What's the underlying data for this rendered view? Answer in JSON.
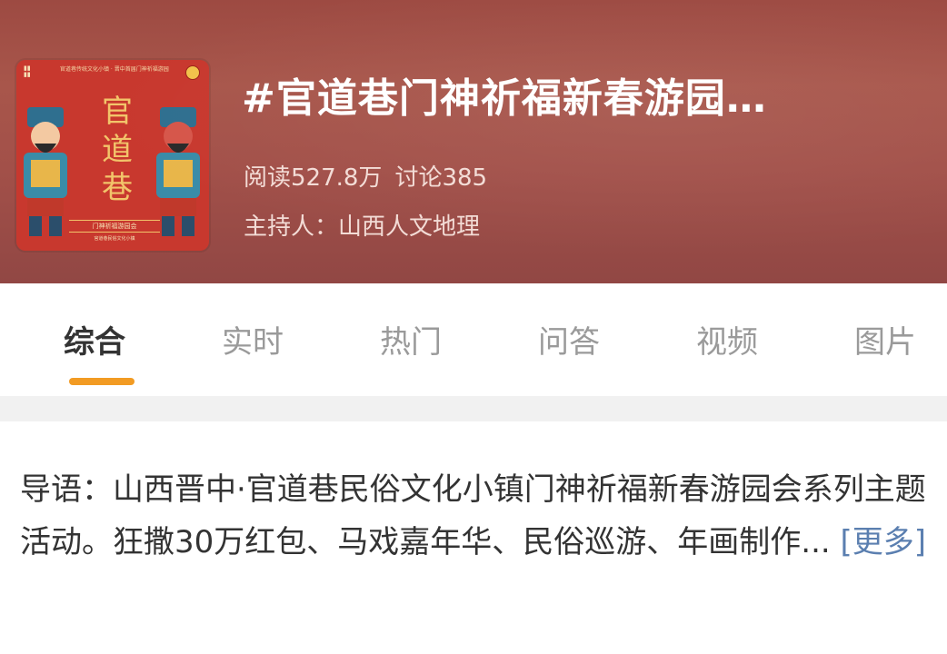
{
  "topic": {
    "title": "#官道巷门神祈福新春游园…",
    "reads": "阅读527.8万",
    "discussions": "讨论385",
    "host": "主持人：山西人文地理",
    "cover": {
      "title": "官道巷",
      "subtitle": "门神祈福游园会",
      "top_text": "官道巷传统文化小镇 · 晋中首届门神祈福游园",
      "footer": "官道巷民俗文化小镇"
    }
  },
  "tabs": [
    {
      "label": "综合",
      "active": true
    },
    {
      "label": "实时",
      "active": false
    },
    {
      "label": "热门",
      "active": false
    },
    {
      "label": "问答",
      "active": false
    },
    {
      "label": "视频",
      "active": false
    },
    {
      "label": "图片",
      "active": false
    }
  ],
  "intro": {
    "text": "导语：山西晋中·官道巷民俗文化小镇门神祈福新春游园会系列主题活动。狂撒30万红包、马戏嘉年华、民俗巡游、年画制作... ",
    "more_label": "[更多]"
  },
  "colors": {
    "header_bg": "#a25049",
    "accent": "#f29b23",
    "link": "#5b7fb0"
  }
}
